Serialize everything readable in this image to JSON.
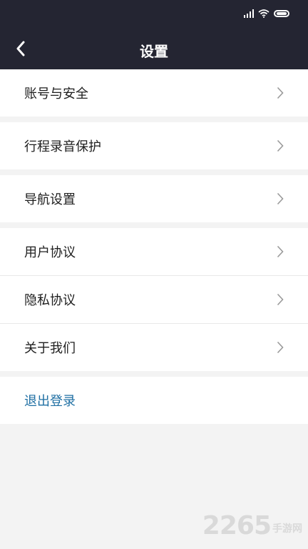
{
  "header": {
    "title": "设置",
    "back_icon": "chevron-left-icon"
  },
  "status_bar": {
    "icons": [
      "signal-icon",
      "wifi-icon",
      "battery-icon"
    ]
  },
  "menu": {
    "account_security": "账号与安全",
    "trip_recording": "行程录音保护",
    "navigation_settings": "导航设置",
    "user_agreement": "用户协议",
    "privacy_agreement": "隐私协议",
    "about_us": "关于我们",
    "logout": "退出登录"
  },
  "watermark": {
    "number": "2265",
    "text": "手游网"
  },
  "colors": {
    "header_bg": "#242532",
    "logout_text": "#1f6fa3",
    "page_bg": "#f3f3f3"
  }
}
